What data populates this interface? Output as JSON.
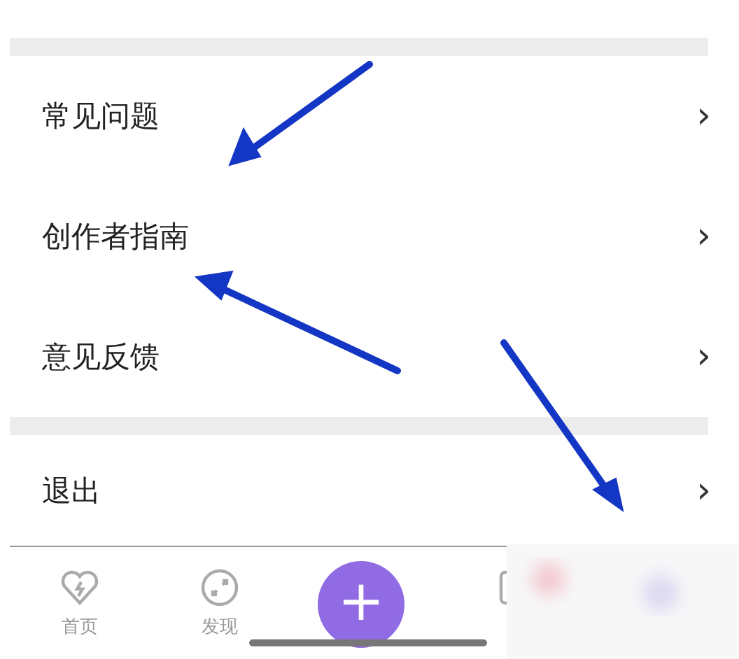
{
  "menu_groups": [
    {
      "items": [
        {
          "label": "常见问题",
          "chevron": "›"
        },
        {
          "label": "创作者指南",
          "chevron": "›"
        },
        {
          "label": "意见反馈",
          "chevron": "›"
        }
      ]
    },
    {
      "items": [
        {
          "label": "退出",
          "chevron": "›"
        }
      ]
    }
  ],
  "tab_bar": {
    "tabs": [
      {
        "kind": "tab",
        "label": "首页"
      },
      {
        "kind": "tab",
        "label": "发现"
      },
      {
        "kind": "add",
        "label": "+"
      },
      {
        "kind": "cut"
      }
    ]
  }
}
